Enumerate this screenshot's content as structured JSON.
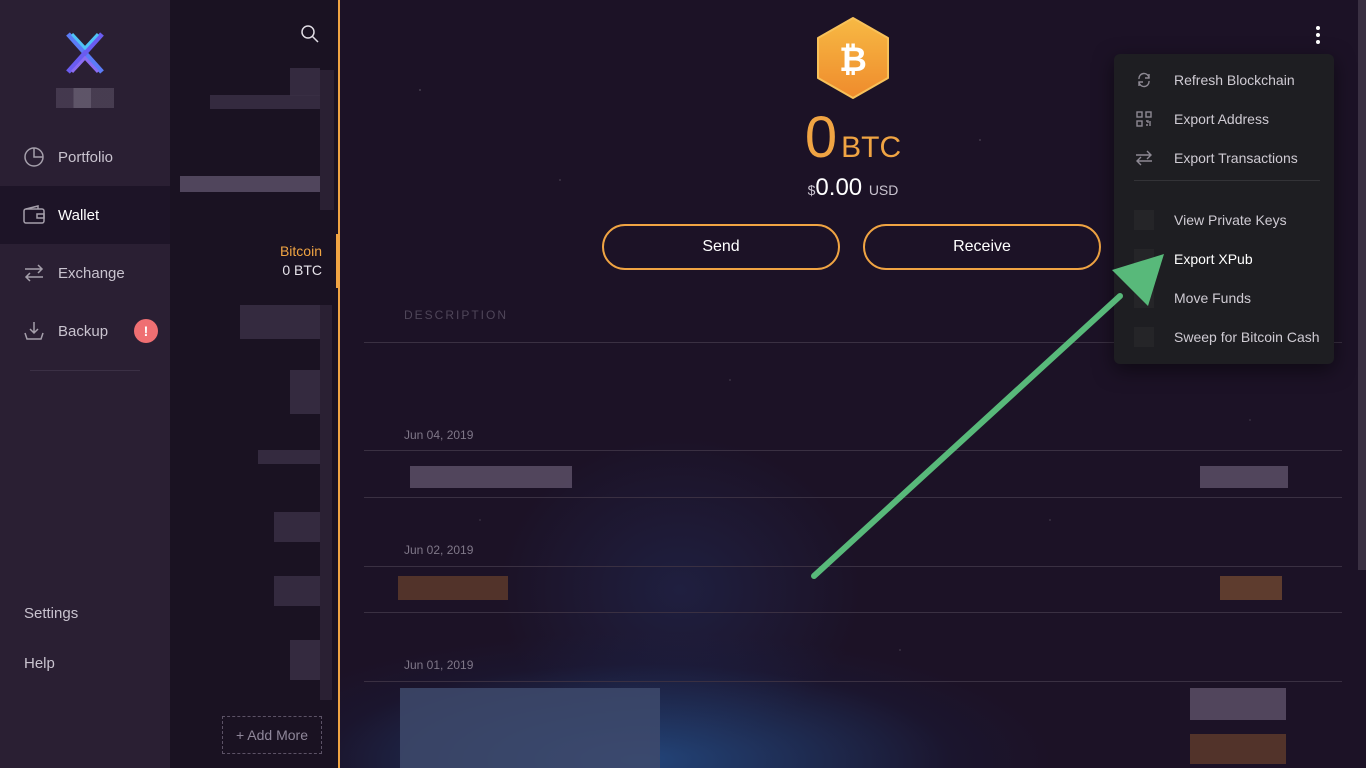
{
  "sidebar": {
    "items": [
      {
        "label": "Portfolio",
        "icon": "pie-chart-icon"
      },
      {
        "label": "Wallet",
        "icon": "wallet-icon"
      },
      {
        "label": "Exchange",
        "icon": "exchange-arrows-icon"
      },
      {
        "label": "Backup",
        "icon": "download-tray-icon"
      }
    ],
    "backup_badge": "!",
    "settings_label": "Settings",
    "help_label": "Help"
  },
  "wallet_list": {
    "selected_coin": {
      "name": "Bitcoin",
      "balance": "0 BTC"
    },
    "add_more_label": "+ Add More"
  },
  "asset": {
    "symbol_glyph": "₿",
    "balance_amount": "0",
    "balance_unit": "BTC",
    "usd_symbol": "$",
    "usd_amount": "0.00",
    "usd_currency": "USD"
  },
  "actions": {
    "send_label": "Send",
    "receive_label": "Receive"
  },
  "transactions": {
    "column_header": "DESCRIPTION",
    "dates": [
      "Jun 04, 2019",
      "Jun 02, 2019",
      "Jun 01, 2019"
    ]
  },
  "menu": {
    "items": [
      {
        "label": "Refresh Blockchain",
        "icon": "refresh-icon"
      },
      {
        "label": "Export Address",
        "icon": "qr-code-icon"
      },
      {
        "label": "Export Transactions",
        "icon": "transfer-arrows-icon"
      },
      {
        "label": "View Private Keys",
        "icon": ""
      },
      {
        "label": "Export XPub",
        "icon": ""
      },
      {
        "label": "Move Funds",
        "icon": ""
      },
      {
        "label": "Sweep for Bitcoin Cash",
        "icon": ""
      }
    ]
  },
  "colors": {
    "accent": "#f0a443",
    "annotation_arrow": "#58b97a",
    "badge": "#ef6f72",
    "background": "#1c1226"
  }
}
